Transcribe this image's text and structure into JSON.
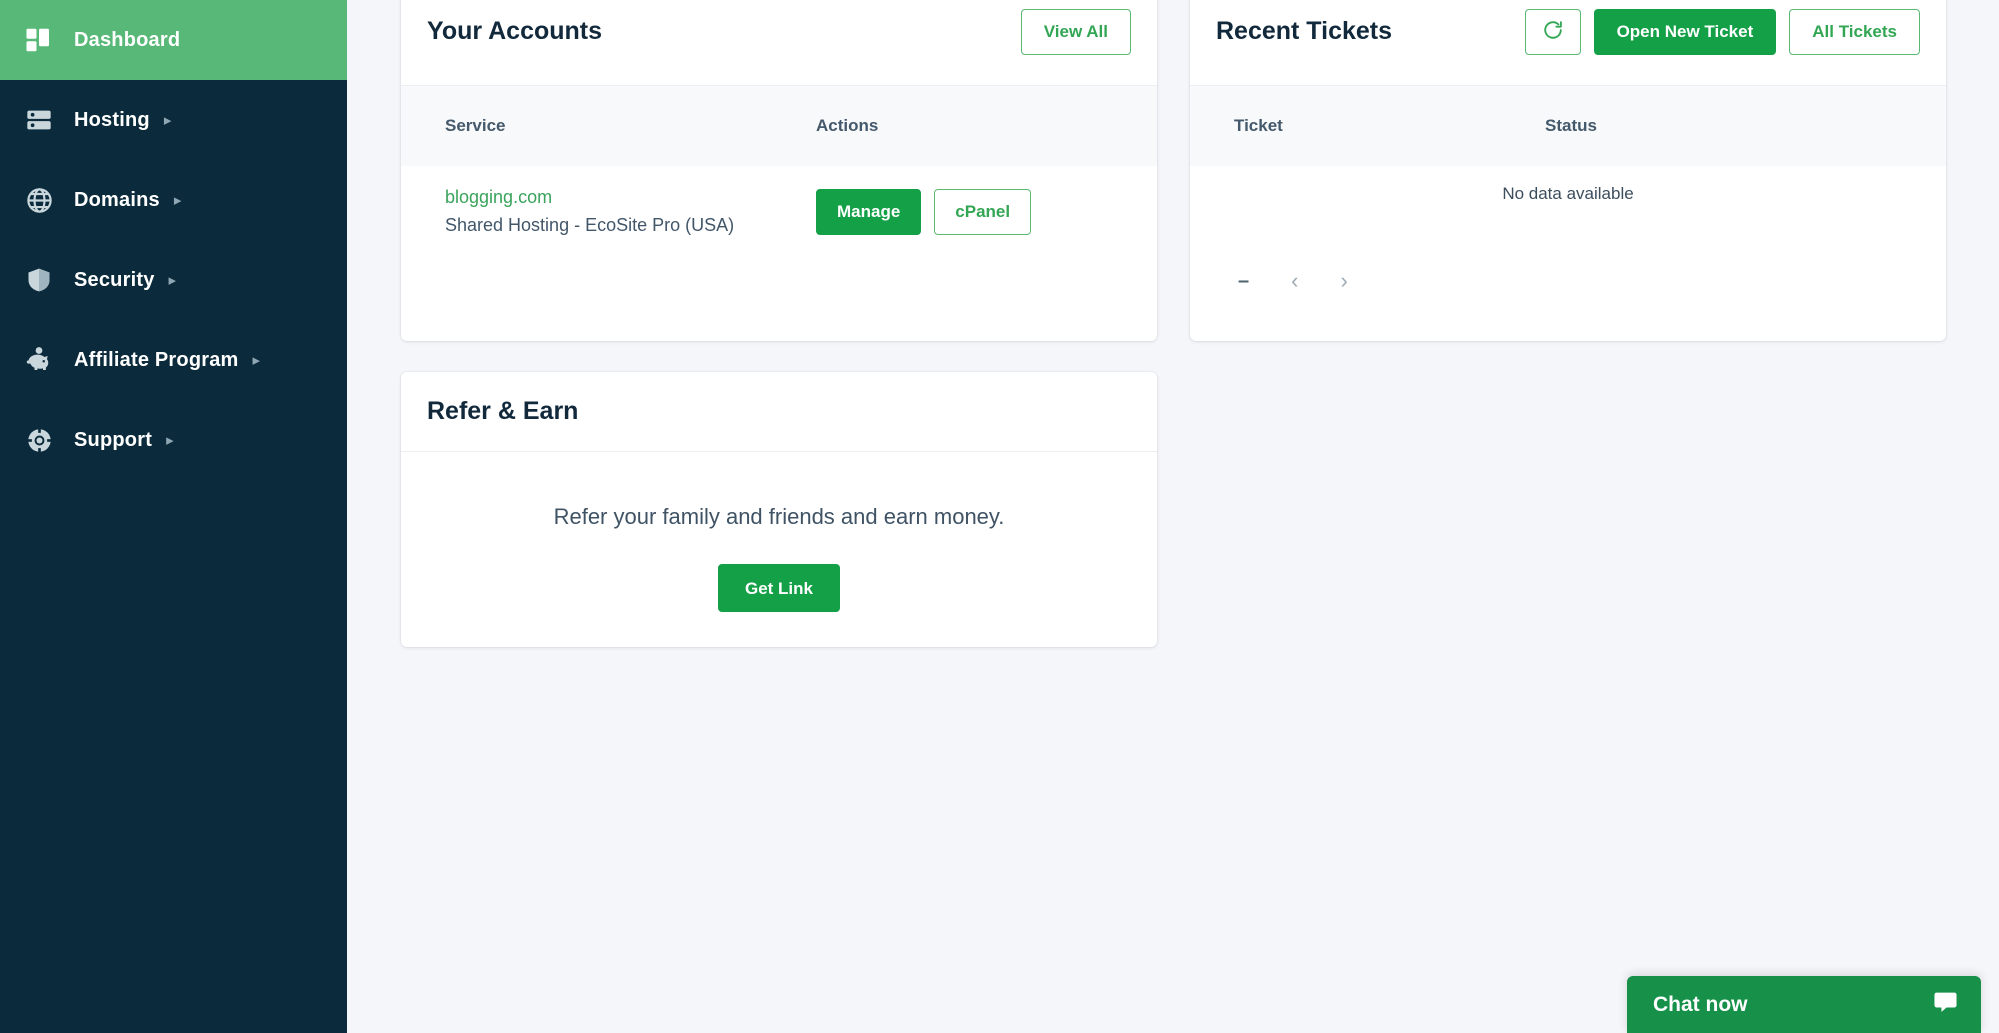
{
  "sidebar": {
    "items": [
      {
        "label": "Dashboard",
        "icon": "dashboard-grid-icon",
        "active": true,
        "caret": false
      },
      {
        "label": "Hosting",
        "icon": "server-icon",
        "active": false,
        "caret": true
      },
      {
        "label": "Domains",
        "icon": "globe-icon",
        "active": false,
        "caret": true
      },
      {
        "label": "Security",
        "icon": "shield-icon",
        "active": false,
        "caret": true
      },
      {
        "label": "Affiliate Program",
        "icon": "piggy-bank-icon",
        "active": false,
        "caret": true
      },
      {
        "label": "Support",
        "icon": "life-ring-icon",
        "active": false,
        "caret": true
      }
    ],
    "caret_glyph": "▸"
  },
  "accounts_card": {
    "title": "Your Accounts",
    "view_all_label": "View All",
    "columns": [
      "Service",
      "Actions"
    ],
    "rows": [
      {
        "service_name": "blogging.com",
        "service_plan": "Shared Hosting - EcoSite Pro (USA)",
        "manage_label": "Manage",
        "cpanel_label": "cPanel"
      }
    ]
  },
  "tickets_card": {
    "title": "Recent Tickets",
    "refresh_icon": "refresh-icon",
    "open_new_ticket_label": "Open New Ticket",
    "all_tickets_label": "All Tickets",
    "columns": [
      "Ticket",
      "Status"
    ],
    "empty_message": "No data available",
    "pagination": {
      "page_indicator": "–",
      "prev_glyph": "‹",
      "next_glyph": "›"
    }
  },
  "refer_card": {
    "title": "Refer & Earn",
    "description": "Refer your family and friends and earn money.",
    "get_link_label": "Get Link"
  },
  "chat": {
    "label": "Chat now",
    "icon": "chat-bubble-icon"
  },
  "colors": {
    "sidebar_bg": "#0b2b3c",
    "active_nav_bg": "#57b877",
    "brand_green": "#13a047",
    "outline_green": "#33a654",
    "page_bg": "#f5f6fa",
    "heading": "#12293c",
    "chat_green": "#17914a"
  }
}
